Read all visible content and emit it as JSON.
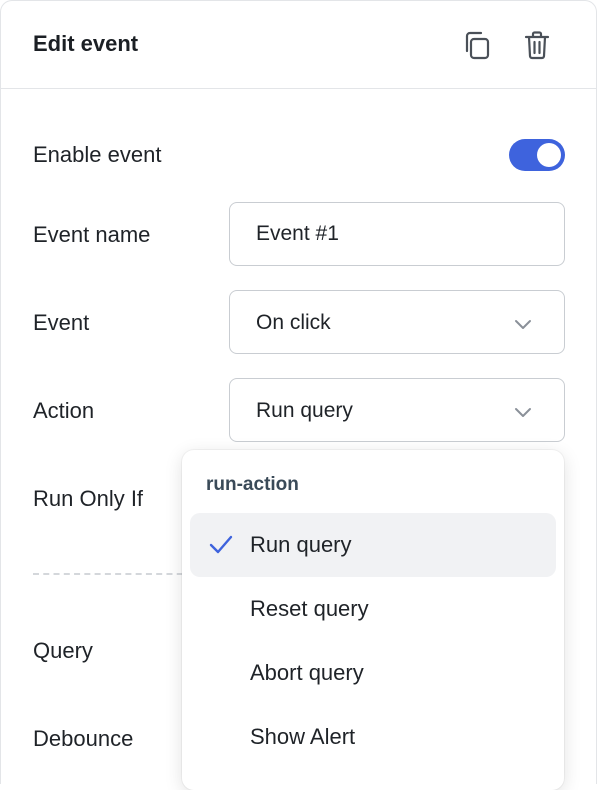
{
  "header": {
    "title": "Edit event",
    "copy_icon": "copy-icon",
    "delete_icon": "trash-icon"
  },
  "form": {
    "enable_label": "Enable event",
    "enabled": true,
    "event_name_label": "Event name",
    "event_name_value": "Event #1",
    "event_label": "Event",
    "event_value": "On click",
    "action_label": "Action",
    "action_value": "Run query",
    "run_only_if_label": "Run Only If",
    "query_label": "Query",
    "debounce_label": "Debounce"
  },
  "dropdown": {
    "group_label": "run-action",
    "items": [
      {
        "label": "Run query",
        "selected": true
      },
      {
        "label": "Reset query",
        "selected": false
      },
      {
        "label": "Abort query",
        "selected": false
      },
      {
        "label": "Show Alert",
        "selected": false
      }
    ]
  },
  "colors": {
    "accent": "#3e63dd",
    "selected_bg": "#f1f2f4",
    "border": "#c9cdd2"
  }
}
